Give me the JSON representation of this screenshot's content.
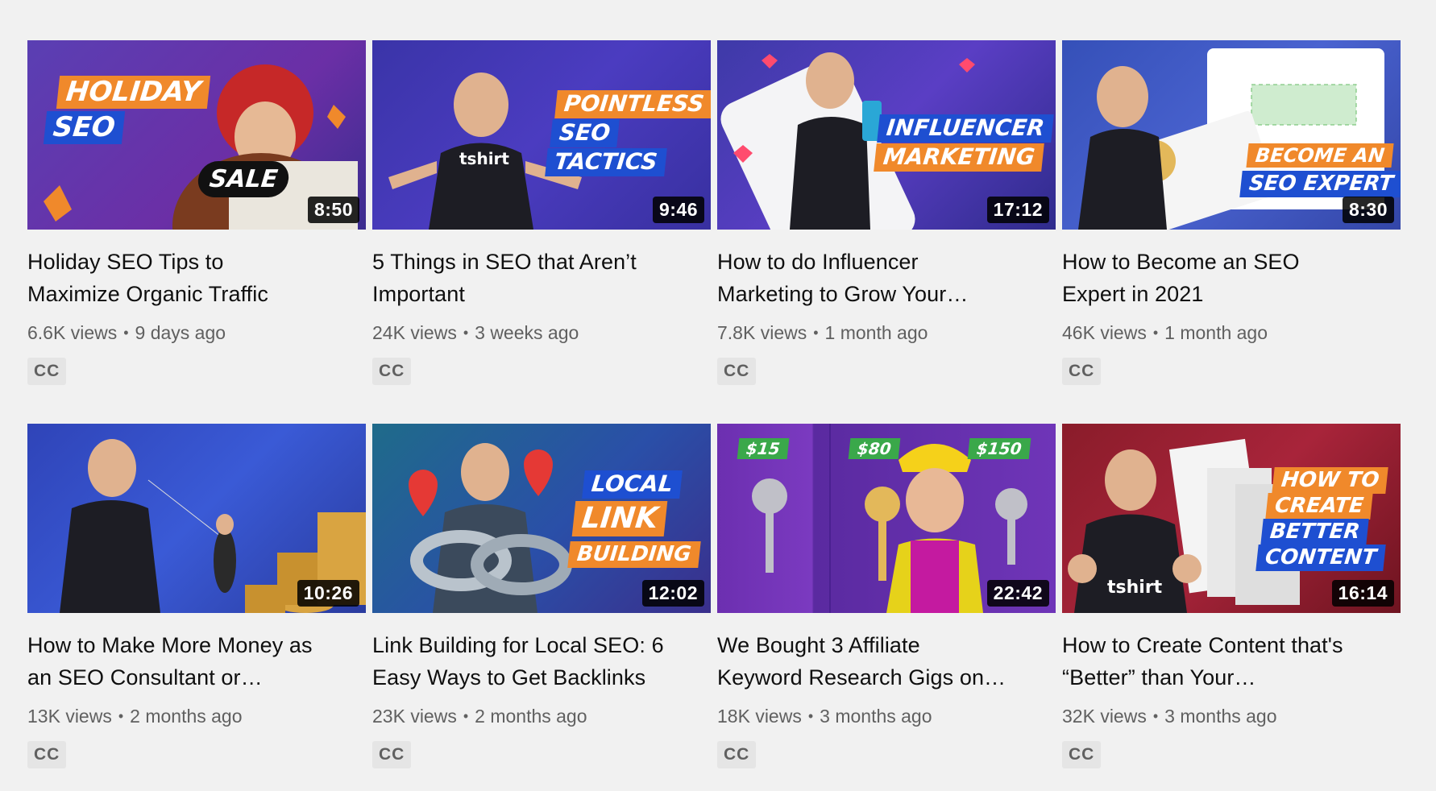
{
  "videos": [
    {
      "title": "Holiday SEO Tips to Maximize Organic Traffic",
      "title_l1": "Holiday SEO Tips to",
      "title_l2": "Maximize Organic Traffic",
      "views": "6.6K views",
      "age": "9 days ago",
      "duration": "8:50",
      "badge": "CC",
      "thumb_text": [
        "HOLIDAY",
        "SEO",
        "SALE"
      ]
    },
    {
      "title": "5 Things in SEO that Aren’t Important",
      "title_l1": "5 Things in SEO that Aren’t",
      "title_l2": "Important",
      "views": "24K views",
      "age": "3 weeks ago",
      "duration": "9:46",
      "badge": "CC",
      "thumb_text": [
        "POINTLESS",
        "SEO",
        "TACTICS",
        "tshirt"
      ]
    },
    {
      "title": "How to do Influencer Marketing to Grow Your…",
      "title_l1": "How to do Influencer",
      "title_l2": "Marketing to Grow Your…",
      "views": "7.8K views",
      "age": "1 month ago",
      "duration": "17:12",
      "badge": "CC",
      "thumb_text": [
        "INFLUENCER",
        "MARKETING"
      ]
    },
    {
      "title": "How to Become an SEO Expert in 2021",
      "title_l1": "How to Become an SEO",
      "title_l2": "Expert in 2021",
      "views": "46K views",
      "age": "1 month ago",
      "duration": "8:30",
      "badge": "CC",
      "thumb_text": [
        "BECOME AN",
        "SEO EXPERT"
      ]
    },
    {
      "title": "How to Make More Money as an SEO Consultant or…",
      "title_l1": "How to Make More Money as",
      "title_l2": "an SEO Consultant or…",
      "views": "13K views",
      "age": "2 months ago",
      "duration": "10:26",
      "badge": "CC",
      "thumb_text": []
    },
    {
      "title": "Link Building for Local SEO: 6 Easy Ways to Get Backlinks",
      "title_l1": "Link Building for Local SEO: 6",
      "title_l2": "Easy Ways to Get Backlinks",
      "views": "23K views",
      "age": "2 months ago",
      "duration": "12:02",
      "badge": "CC",
      "thumb_text": [
        "LOCAL",
        "LINK",
        "BUILDING"
      ]
    },
    {
      "title": "We Bought 3 Affiliate Keyword Research Gigs on…",
      "title_l1": "We Bought 3 Affiliate",
      "title_l2": "Keyword Research Gigs on…",
      "views": "18K views",
      "age": "3 months ago",
      "duration": "22:42",
      "badge": "CC",
      "thumb_text": [
        "$15",
        "$80",
        "$150"
      ]
    },
    {
      "title": "How to Create Content that's “Better” than Your…",
      "title_l1": "How to Create Content that's",
      "title_l2": "“Better” than Your…",
      "views": "32K views",
      "age": "3 months ago",
      "duration": "16:14",
      "badge": "CC",
      "thumb_text": [
        "HOW TO",
        "CREATE",
        "BETTER",
        "CONTENT",
        "tshirt"
      ]
    }
  ],
  "colors": {
    "background": "#f1f1f1",
    "orange": "#f0892b",
    "blue": "#1e4fd1",
    "meta_text": "#606060"
  }
}
